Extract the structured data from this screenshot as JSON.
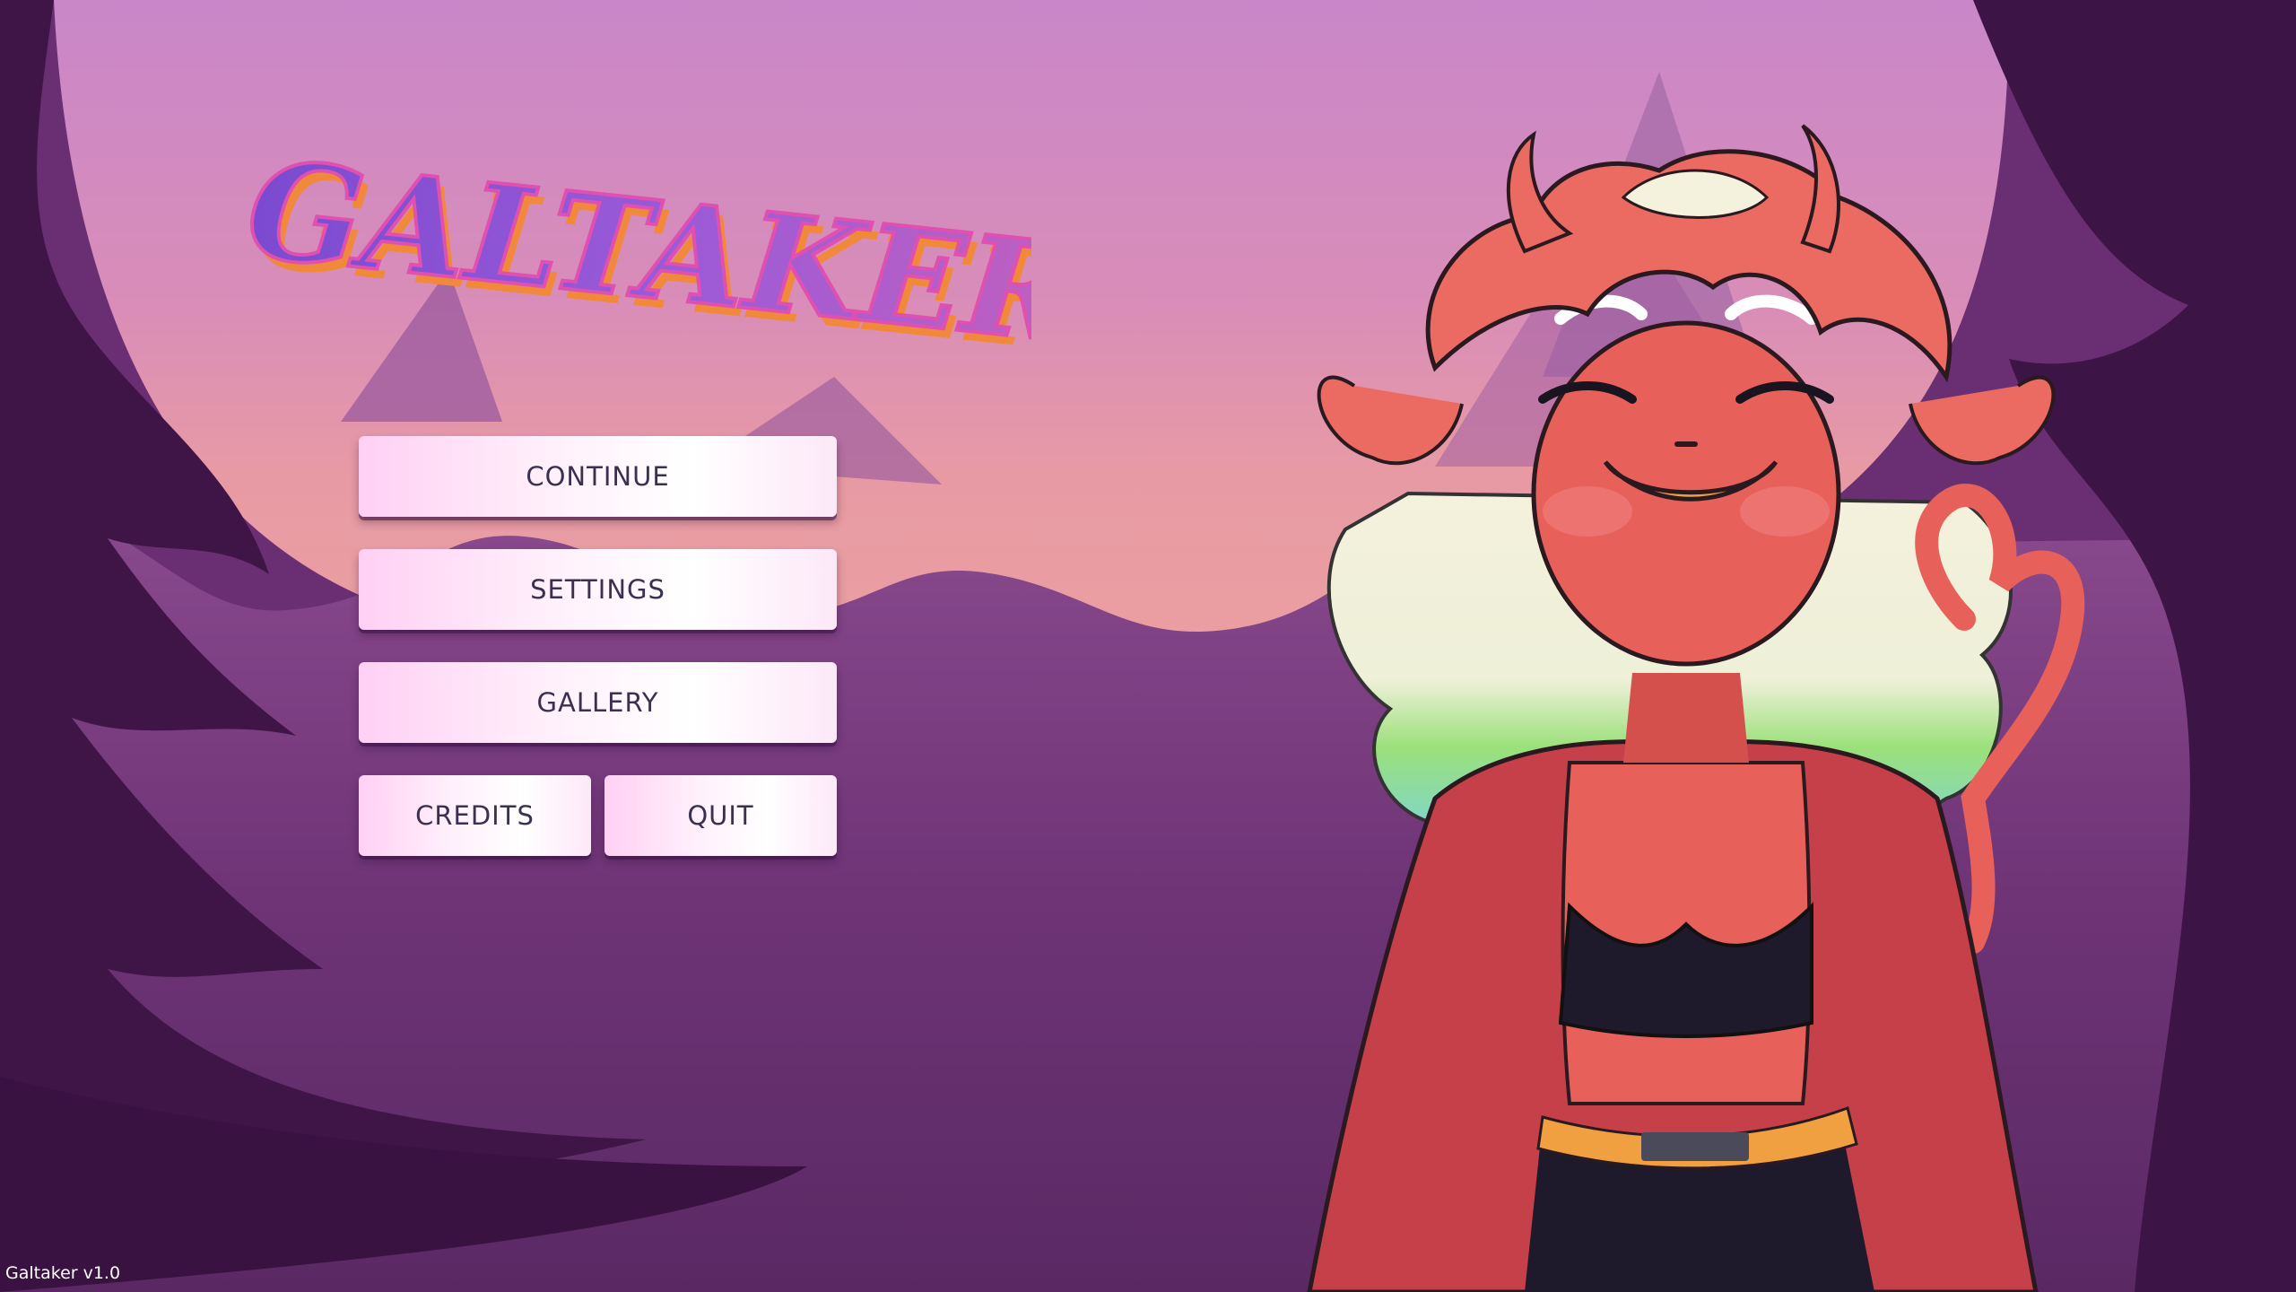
{
  "game": {
    "title": "GALTAKER",
    "version": "Galtaker v1.0"
  },
  "menu": {
    "continue_label": "CONTINUE",
    "settings_label": "SETTINGS",
    "gallery_label": "GALLERY",
    "credits_label": "CREDITS",
    "quit_label": "QUIT"
  },
  "colors": {
    "sky": "#c986c8",
    "forest_dark": "#4a1a55",
    "button_pink": "#ffd0f4",
    "button_text": "#3a3050",
    "character_skin": "#e8605a"
  },
  "icons": [
    "galtaker-logo",
    "demon-girl-character"
  ]
}
